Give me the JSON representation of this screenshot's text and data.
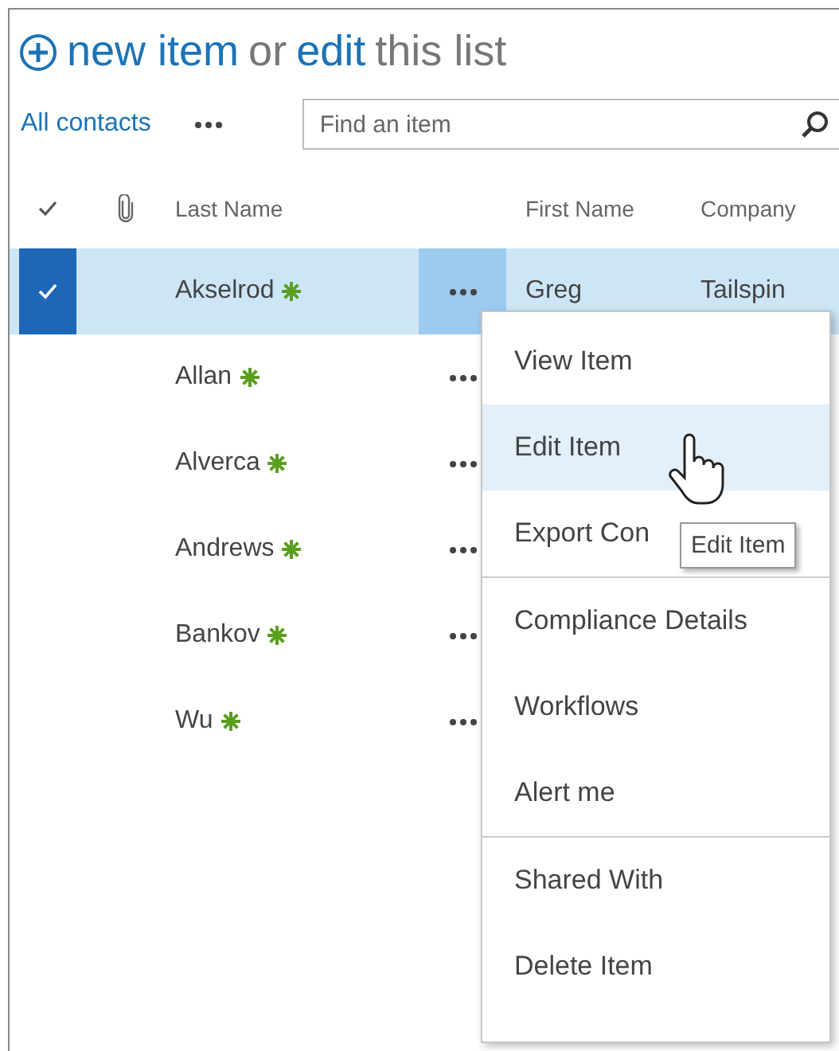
{
  "header": {
    "new_item": "new item",
    "or": "or",
    "edit": "edit",
    "this_list": "this list"
  },
  "view": {
    "label": "All contacts"
  },
  "search": {
    "placeholder": "Find an item"
  },
  "columns": [
    "Last Name",
    "First Name",
    "Company"
  ],
  "rows": [
    {
      "last_name": "Akselrod",
      "first_name": "Greg",
      "company": "Tailspin",
      "new": true,
      "selected": true
    },
    {
      "last_name": "Allan",
      "new": true,
      "selected": false
    },
    {
      "last_name": "Alverca",
      "new": true,
      "selected": false
    },
    {
      "last_name": "Andrews",
      "new": true,
      "selected": false
    },
    {
      "last_name": "Bankov",
      "new": true,
      "selected": false
    },
    {
      "last_name": "Wu",
      "new": true,
      "selected": false
    }
  ],
  "menu": {
    "groups": [
      [
        {
          "label": "View Item",
          "hovered": false
        },
        {
          "label": "Edit Item",
          "hovered": true
        },
        {
          "label": "Export Con",
          "hovered": false
        }
      ],
      [
        {
          "label": "Compliance Details",
          "hovered": false
        },
        {
          "label": "Workflows",
          "hovered": false
        },
        {
          "label": "Alert me",
          "hovered": false
        }
      ],
      [
        {
          "label": "Shared With",
          "hovered": false
        },
        {
          "label": "Delete Item",
          "hovered": false
        }
      ]
    ]
  },
  "tooltip": "Edit Item"
}
